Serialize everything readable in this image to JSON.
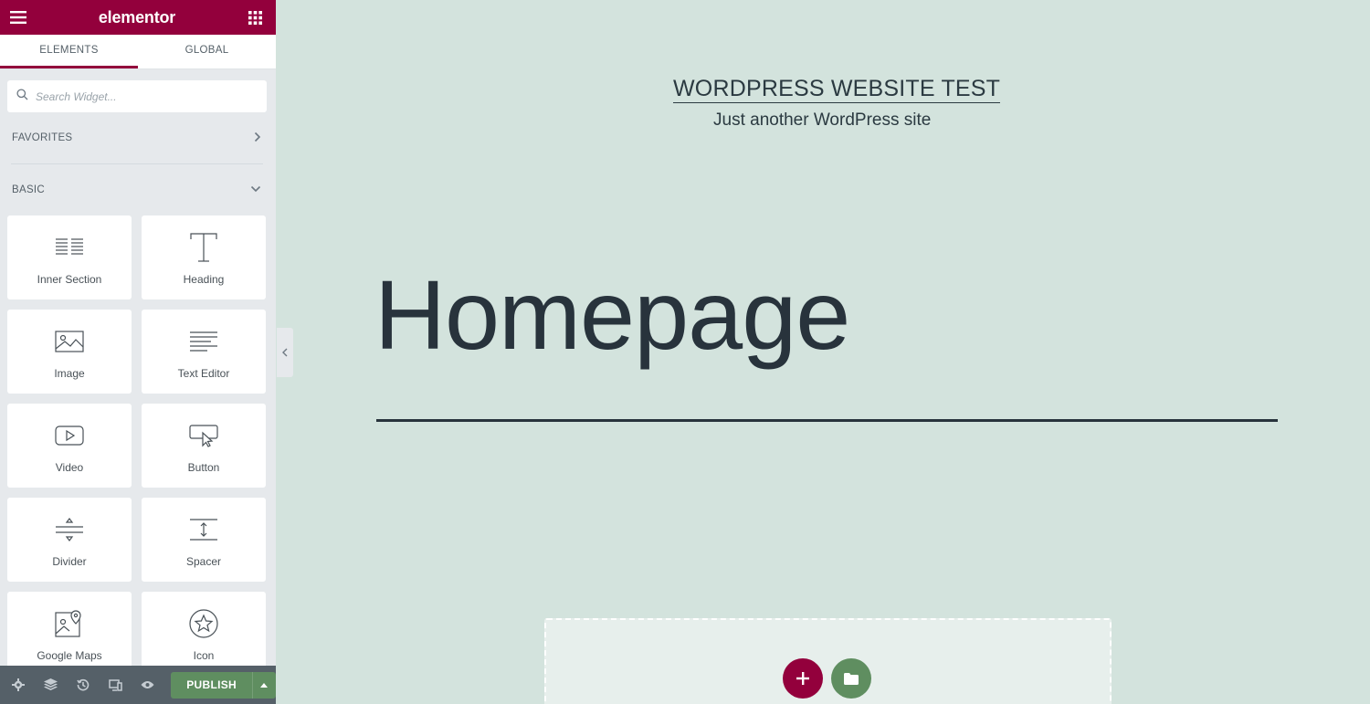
{
  "panel": {
    "logo": "elementor",
    "tabs": [
      {
        "label": "ELEMENTS"
      },
      {
        "label": "GLOBAL"
      }
    ],
    "search_placeholder": "Search Widget...",
    "categories": {
      "favorites": "FAVORITES",
      "basic": "BASIC"
    },
    "widgets": [
      {
        "label": "Inner Section",
        "icon": "inner-section-icon"
      },
      {
        "label": "Heading",
        "icon": "heading-icon"
      },
      {
        "label": "Image",
        "icon": "image-icon"
      },
      {
        "label": "Text Editor",
        "icon": "text-editor-icon"
      },
      {
        "label": "Video",
        "icon": "video-icon"
      },
      {
        "label": "Button",
        "icon": "button-icon"
      },
      {
        "label": "Divider",
        "icon": "divider-icon"
      },
      {
        "label": "Spacer",
        "icon": "spacer-icon"
      },
      {
        "label": "Google Maps",
        "icon": "google-maps-icon"
      },
      {
        "label": "Icon",
        "icon": "star-icon"
      }
    ],
    "footer": {
      "publish_label": "PUBLISH",
      "icons": [
        "settings-icon",
        "navigator-icon",
        "history-icon",
        "responsive-icon",
        "preview-icon"
      ]
    }
  },
  "canvas": {
    "site_title": "WORDPRESS WEBSITE TEST",
    "tagline": "Just another WordPress site",
    "page_title": "Homepage"
  },
  "colors": {
    "brand": "#93003c",
    "canvas_bg": "#d3e3dd",
    "panel_bg": "#e6e9ec",
    "publish": "#5f8e60",
    "text_dark": "#28333c"
  }
}
